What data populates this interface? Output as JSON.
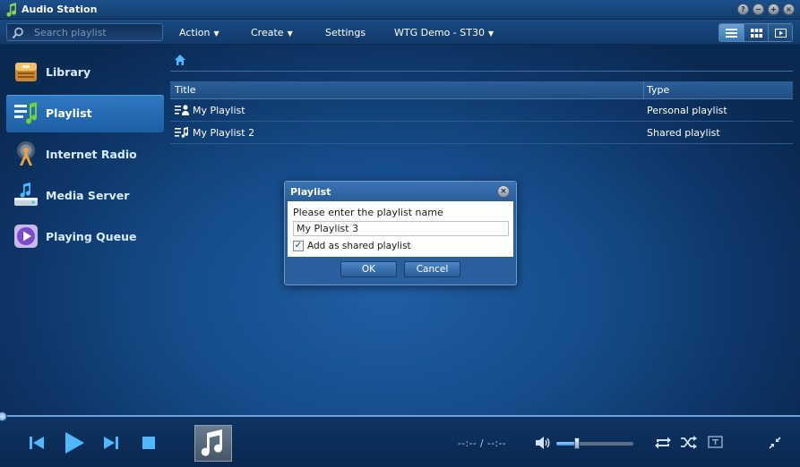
{
  "window": {
    "title": "Audio Station",
    "controls": [
      "?",
      "−",
      "+",
      "×"
    ]
  },
  "toolbar": {
    "search_placeholder": "Search playlist",
    "action_label": "Action",
    "create_label": "Create",
    "settings_label": "Settings",
    "device_label": "WTG Demo - ST30"
  },
  "sidebar": {
    "items": [
      {
        "label": "Library",
        "icon": "library-icon"
      },
      {
        "label": "Playlist",
        "icon": "playlist-icon",
        "active": true
      },
      {
        "label": "Internet Radio",
        "icon": "internet-radio-icon"
      },
      {
        "label": "Media Server",
        "icon": "media-server-icon"
      },
      {
        "label": "Playing Queue",
        "icon": "playing-queue-icon"
      }
    ]
  },
  "grid": {
    "columns": {
      "title": "Title",
      "type": "Type"
    },
    "rows": [
      {
        "title": "My Playlist",
        "type": "Personal playlist",
        "icon": "personal-playlist-icon"
      },
      {
        "title": "My Playlist 2",
        "type": "Shared playlist",
        "icon": "shared-playlist-icon"
      }
    ]
  },
  "dialog": {
    "title": "Playlist",
    "prompt": "Please enter the playlist name",
    "name_value": "My Playlist 3",
    "shared_label": "Add as shared playlist",
    "shared_checked": true,
    "ok_label": "OK",
    "cancel_label": "Cancel",
    "close_glyph": "×"
  },
  "player": {
    "time": "--:-- / --:--",
    "volume": 0.27
  },
  "colors": {
    "accent": "#2f79c2",
    "background": "#164c8a",
    "icon_blue": "#4fb8ff"
  }
}
